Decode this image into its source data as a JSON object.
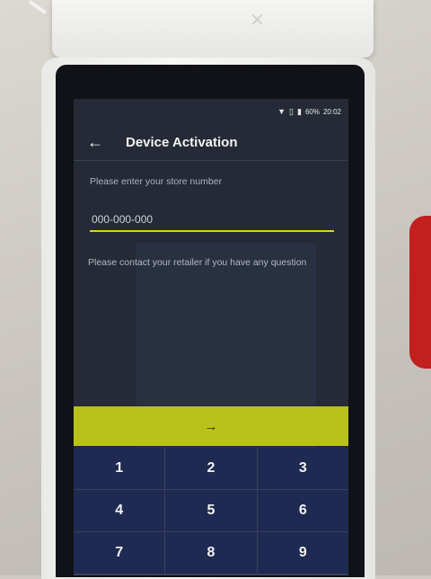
{
  "status_bar": {
    "wifi_icon": "wifi-icon",
    "signal_icon": "sim-icon",
    "battery_icon": "battery-icon",
    "battery_text": "60%",
    "time": "20:02"
  },
  "app_bar": {
    "back_icon": "back-arrow-icon",
    "back_glyph": "←",
    "title": "Device Activation"
  },
  "form": {
    "prompt": "Please enter your store number",
    "store_number_placeholder": "000-000-000",
    "store_number_value": "",
    "help": "Please contact your retailer if you have any question"
  },
  "submit": {
    "icon": "arrow-right-icon",
    "glyph": "→"
  },
  "keypad": {
    "keys": [
      "1",
      "2",
      "3",
      "4",
      "5",
      "6",
      "7",
      "8",
      "9"
    ]
  },
  "colors": {
    "accent": "#b9c21a",
    "screen_bg": "#252a36",
    "keypad_bg": "#1f2a52"
  }
}
